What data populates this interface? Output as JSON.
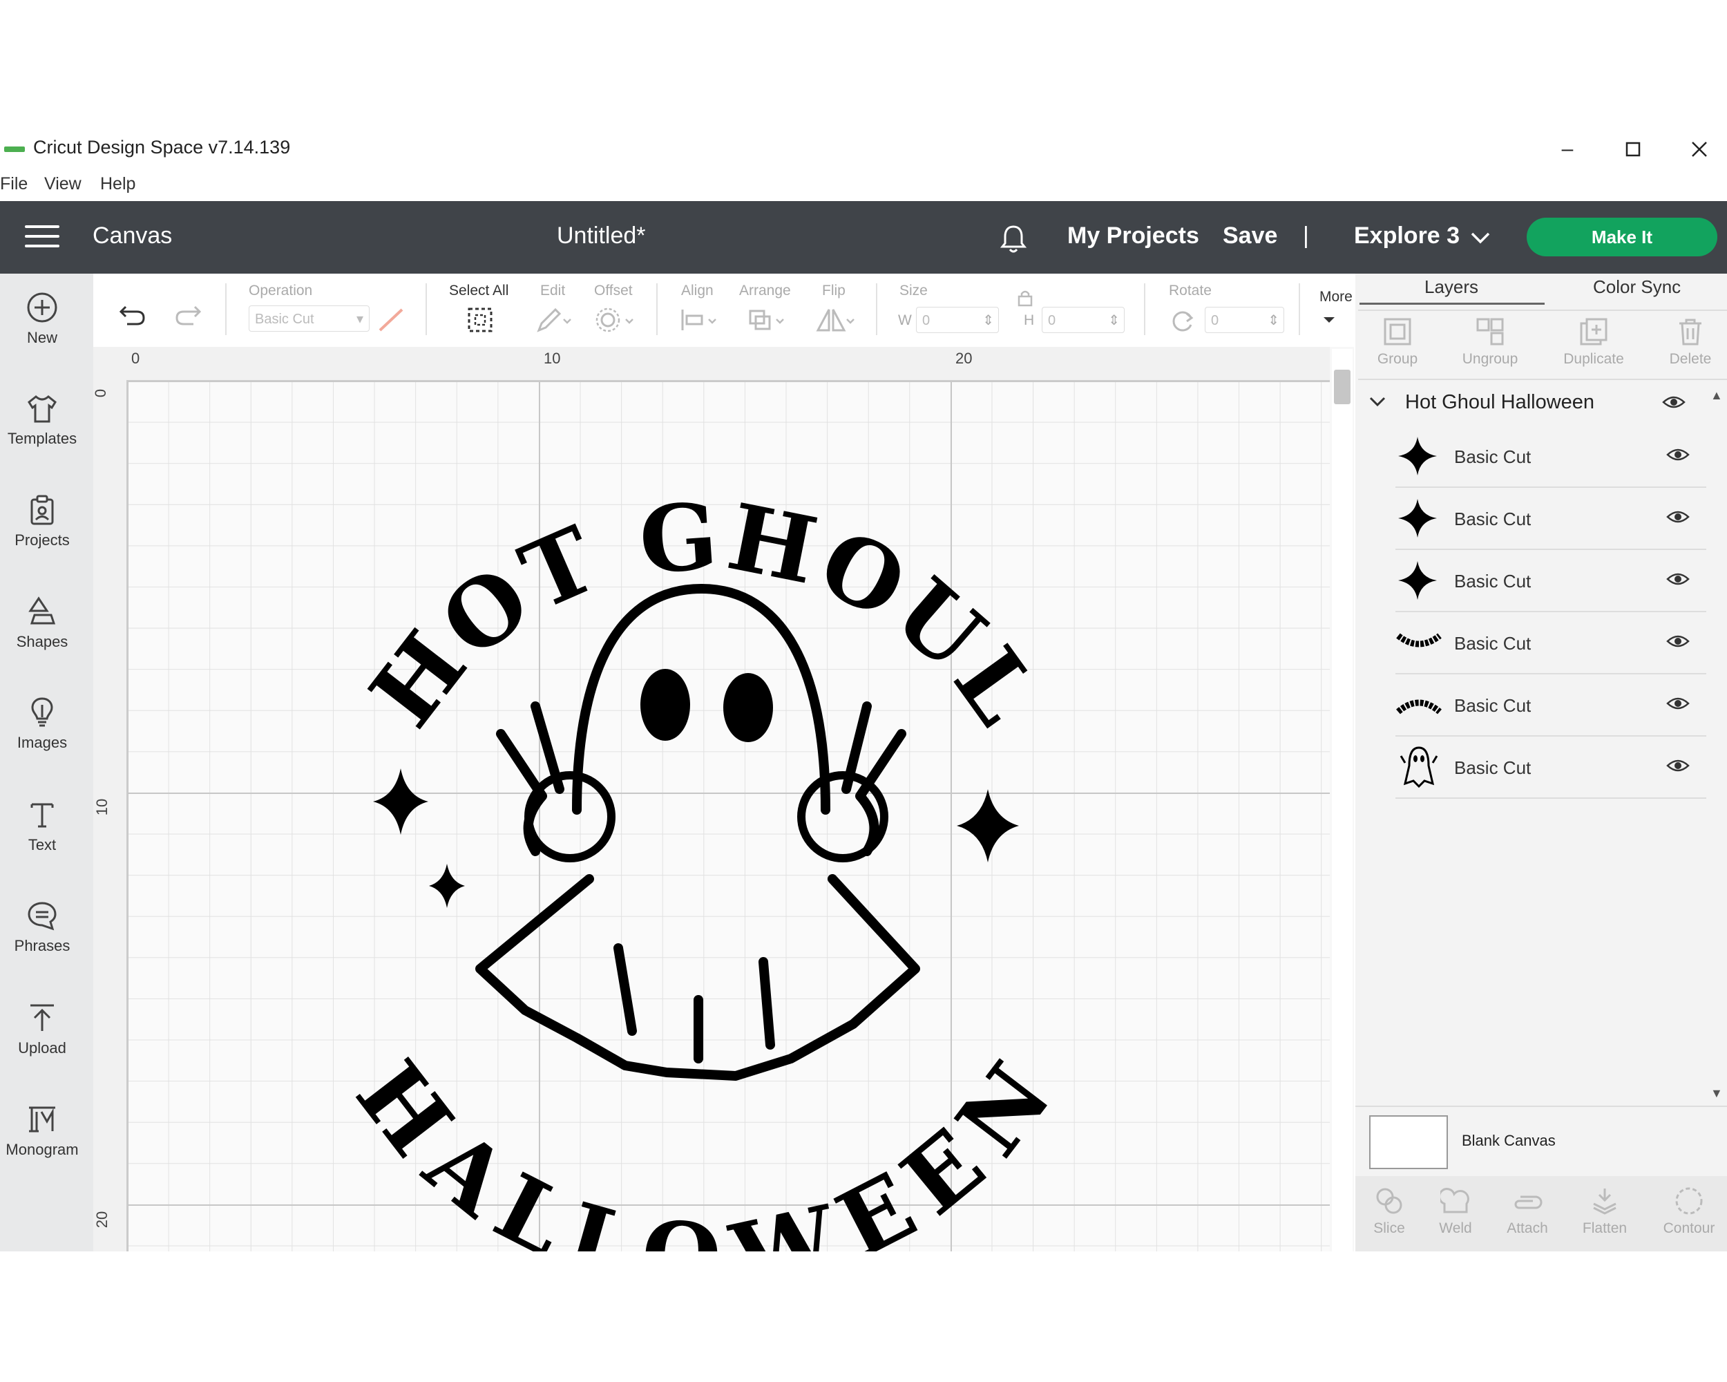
{
  "window": {
    "title": "Cricut Design Space  v7.14.139"
  },
  "menu": [
    "File",
    "View",
    "Help"
  ],
  "header": {
    "section": "Canvas",
    "doc_title": "Untitled*",
    "my_projects": "My Projects",
    "save": "Save",
    "separator": "|",
    "machine": "Explore 3",
    "make_it": "Make It"
  },
  "sidebar": [
    {
      "label": "New",
      "icon": "plus-circle-icon"
    },
    {
      "label": "Templates",
      "icon": "shirt-icon"
    },
    {
      "label": "Projects",
      "icon": "clipboard-icon"
    },
    {
      "label": "Shapes",
      "icon": "shapes-icon"
    },
    {
      "label": "Images",
      "icon": "lightbulb-icon"
    },
    {
      "label": "Text",
      "icon": "text-icon"
    },
    {
      "label": "Phrases",
      "icon": "speech-bubble-icon"
    },
    {
      "label": "Upload",
      "icon": "upload-icon"
    },
    {
      "label": "Monogram",
      "icon": "monogram-icon"
    }
  ],
  "toolbar": {
    "operation_label": "Operation",
    "operation_value": "Basic Cut",
    "select_all": "Select All",
    "edit": "Edit",
    "offset": "Offset",
    "align": "Align",
    "arrange": "Arrange",
    "flip": "Flip",
    "size": "Size",
    "w": "W",
    "h": "H",
    "w_value": "0",
    "h_value": "0",
    "rotate": "Rotate",
    "rotate_value": "0",
    "more": "More"
  },
  "ruler": {
    "top": [
      "0",
      "10",
      "20"
    ],
    "left": [
      "0",
      "10",
      "20"
    ]
  },
  "design": {
    "arc_top": "HOT GHOUL",
    "arc_bottom": "HALLOWEEN"
  },
  "panel": {
    "tabs": [
      "Layers",
      "Color Sync"
    ],
    "actions_top": [
      "Group",
      "Ungroup",
      "Duplicate",
      "Delete"
    ],
    "group_name": "Hot Ghoul Halloween",
    "layers": [
      {
        "label": "Basic Cut",
        "thumb": "star"
      },
      {
        "label": "Basic Cut",
        "thumb": "star"
      },
      {
        "label": "Basic Cut",
        "thumb": "star"
      },
      {
        "label": "Basic Cut",
        "thumb": "halloween-text"
      },
      {
        "label": "Basic Cut",
        "thumb": "hot-ghoul-text"
      },
      {
        "label": "Basic Cut",
        "thumb": "ghost"
      }
    ],
    "blank_canvas": "Blank Canvas",
    "actions_bottom": [
      "Slice",
      "Weld",
      "Attach",
      "Flatten",
      "Contour"
    ]
  },
  "colors": {
    "header": "#404449",
    "make_it": "#12a35e",
    "sidebar": "#e8e9ea"
  }
}
